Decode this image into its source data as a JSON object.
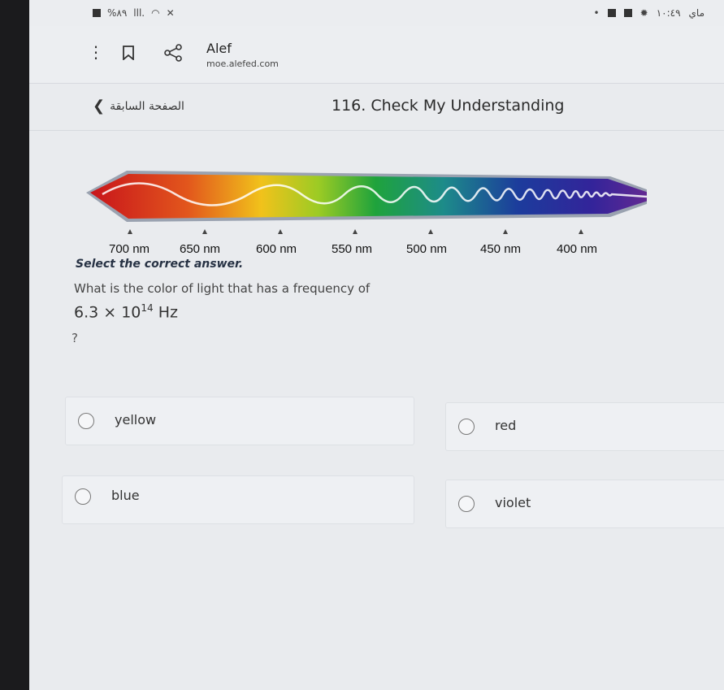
{
  "status": {
    "battery": "%٨٩",
    "signal": "lll.",
    "time": "١٠:٤٩",
    "day": "ماي"
  },
  "browser": {
    "title": "Alef",
    "url": "moe.alefed.com"
  },
  "header": {
    "back_label": "الصفحة السابقة",
    "title": "116. Check My Understanding"
  },
  "spectrum": {
    "labels": [
      "700 nm",
      "650 nm",
      "600 nm",
      "550 nm",
      "500 nm",
      "450 nm",
      "400 nm"
    ]
  },
  "question": {
    "instruction": "Select the correct answer.",
    "text": "What is the color of light that has a frequency of",
    "formula_base": "6.3 × 10",
    "formula_exp": "14",
    "formula_unit": " Hz",
    "qmark": "?"
  },
  "options": [
    "yellow",
    "red",
    "blue",
    "violet"
  ]
}
